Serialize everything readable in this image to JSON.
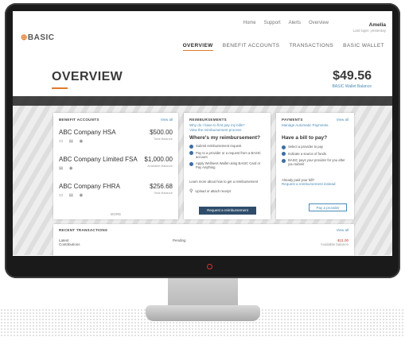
{
  "header": {
    "logo_text": "BASIC",
    "top_links": [
      "Home",
      "Support",
      "Alerts",
      "Overview"
    ],
    "user_name": "Amelia",
    "user_sub": "Last login: yesterday"
  },
  "nav": {
    "items": [
      {
        "label": "OVERVIEW",
        "active": true
      },
      {
        "label": "BENEFIT ACCOUNTS",
        "active": false
      },
      {
        "label": "TRANSACTIONS",
        "active": false
      },
      {
        "label": "BASIC WALLET",
        "active": false
      }
    ]
  },
  "overview": {
    "title": "OVERVIEW",
    "balance": "$49.56",
    "balance_label": "BASIC Wallet Balance"
  },
  "benefit_accounts": {
    "title": "BENEFIT ACCOUNTS",
    "view_all": "View all",
    "accounts": [
      {
        "name": "ABC Company HSA",
        "amount": "$500.00",
        "label": "Total Balance"
      },
      {
        "name": "ABC Company Limited FSA",
        "amount": "$1,000.00",
        "label": "Available Balance"
      },
      {
        "name": "ABC Company FHRA",
        "amount": "$256.68",
        "label": "Total Balance"
      }
    ],
    "more": "MORE"
  },
  "reimbursements": {
    "title": "REIMBURSEMENTS",
    "link1": "Why do I have to first pay my bills?",
    "link2": "View the reimbursement process",
    "question": "Where's my reimbursement?",
    "bullets": [
      "Submit reimbursement request",
      "Pay to a provider or a request from a BASIC account",
      "Apply Wellness Wallet using BASIC Card or Pay Anything"
    ],
    "note": "Learn more about how to get a reimbursement",
    "search": "Upload or attach receipt",
    "button": "Request a reimbursement"
  },
  "payments": {
    "title": "PAYMENTS",
    "view_all": "View all",
    "link": "Manage Automatic Payments",
    "question": "Have a bill to pay?",
    "bullets": [
      "Select a provider to pay",
      "Indicate a source of funds",
      "BASIC pays your provider for you after you submit"
    ],
    "note1": "Already paid your bill?",
    "note2": "Request a reimbursement instead",
    "button": "Pay a provider"
  },
  "recent": {
    "title": "RECENT TRANSACTIONS",
    "view_all": "View all",
    "col1": "Latest",
    "col1b": "Contributions",
    "col2": "Pending",
    "col3": "-$11.00",
    "col3b": "Available balance"
  }
}
